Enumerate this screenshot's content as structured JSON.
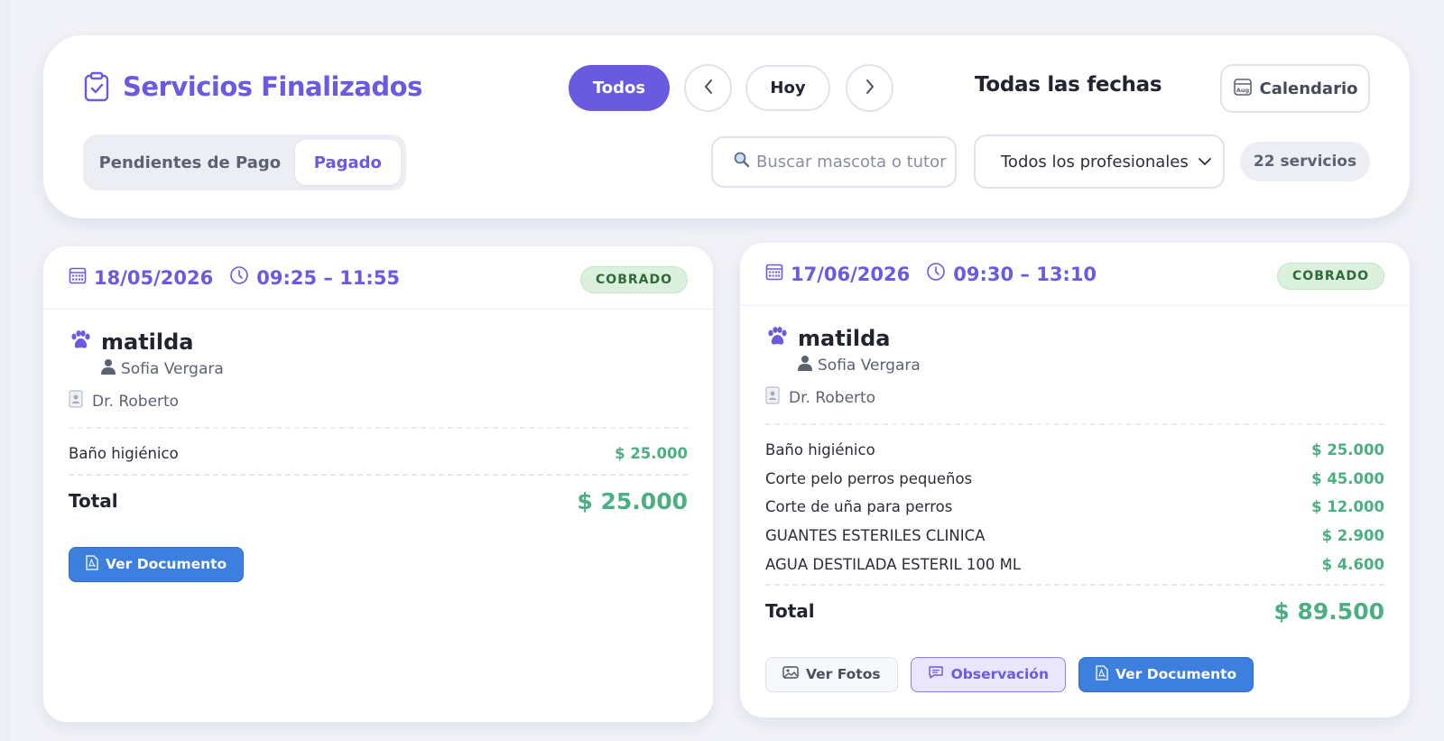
{
  "header": {
    "title": "Servicios Finalizados",
    "todos_label": "Todos",
    "hoy_label": "Hoy",
    "date_range": "Todas las fechas",
    "calendar_label": "Calendario",
    "calendar_icon_text": "Aug",
    "tabs": [
      "Pendientes de Pago",
      "Pagado"
    ],
    "active_tab": "Pagado",
    "search_placeholder": "Buscar mascota o tutor",
    "professional_select": "Todos los profesionales",
    "services_count": "22 servicios"
  },
  "cards": [
    {
      "date": "18/05/2026",
      "time": "09:25 – 11:55",
      "status": "COBRADO",
      "pet": "matilda",
      "owner": "Sofia Vergara",
      "doctor": "Dr. Roberto",
      "items": [
        {
          "name": "Baño higiénico",
          "price": "$ 25.000"
        }
      ],
      "total_label": "Total",
      "total": "$ 25.000",
      "actions": [
        "Ver Documento"
      ]
    },
    {
      "date": "17/06/2026",
      "time": "09:30 – 13:10",
      "status": "COBRADO",
      "pet": "matilda",
      "owner": "Sofia Vergara",
      "doctor": "Dr. Roberto",
      "items": [
        {
          "name": "Baño higiénico",
          "price": "$ 25.000"
        },
        {
          "name": "Corte pelo perros pequeños",
          "price": "$ 45.000"
        },
        {
          "name": "Corte de uña para perros",
          "price": "$ 12.000"
        },
        {
          "name": "GUANTES ESTERILES CLINICA",
          "price": "$ 2.900"
        },
        {
          "name": "AGUA DESTILADA ESTERIL 100 ML",
          "price": "$ 4.600"
        }
      ],
      "total_label": "Total",
      "total": "$ 89.500",
      "actions": [
        "Ver Fotos",
        "Observación",
        "Ver Documento"
      ]
    }
  ],
  "colors": {
    "accent": "#6a5ae0",
    "price_green": "#4caf82",
    "doc_blue": "#3d7fdf",
    "badge_bg": "#dcf1dd"
  }
}
